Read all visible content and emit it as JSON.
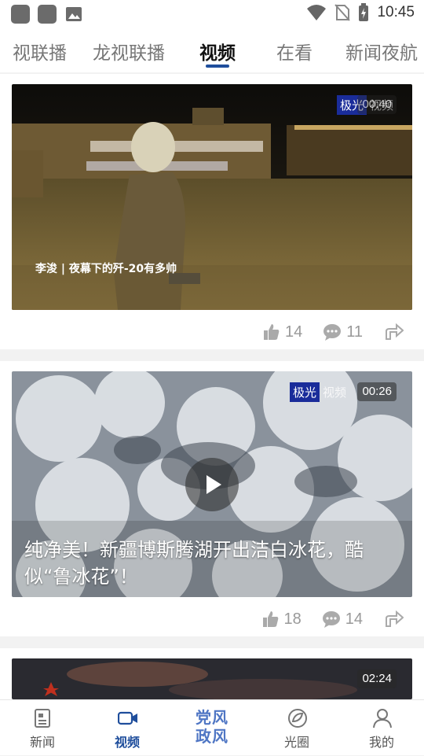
{
  "status_bar": {
    "time": "10:45"
  },
  "tabs": [
    "视联播",
    "龙视联播",
    "视频",
    "在看",
    "新闻夜航"
  ],
  "active_tab": "视频",
  "videos": [
    {
      "duration": "00:40",
      "watermark": [
        "极光",
        "视频"
      ],
      "subtitle": "李浚 | 夜幕下的歼-20有多帅",
      "title": "",
      "likes": "14",
      "comments": "11"
    },
    {
      "duration": "00:26",
      "watermark": [
        "极光",
        "视频"
      ],
      "subtitle": "",
      "title": "纯净美！新疆博斯腾湖开出洁白冰花，酷似“鲁冰花”！",
      "likes": "18",
      "comments": "14"
    },
    {
      "duration": "02:24"
    }
  ],
  "bottom_nav": {
    "items": [
      "新闻",
      "视频",
      "光圈",
      "我的"
    ],
    "center_logo": [
      "党风",
      "政风"
    ],
    "active": "视频"
  },
  "colors": {
    "accent": "#1f4e9c",
    "inactive": "#777777"
  },
  "icons": [
    "thumbs-up-icon",
    "comment-icon",
    "share-icon",
    "newspaper-icon",
    "video-camera-icon",
    "circle-leaf-icon",
    "person-icon"
  ]
}
